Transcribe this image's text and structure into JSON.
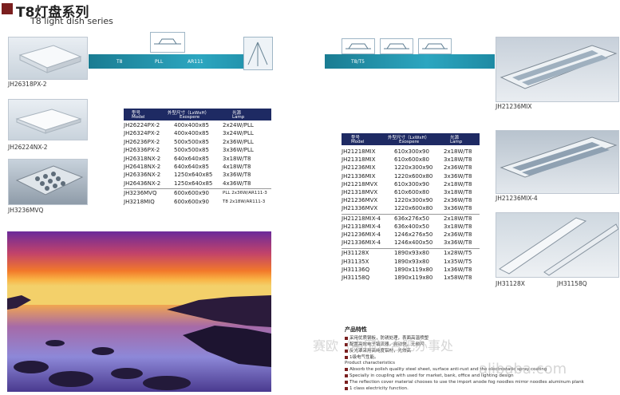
{
  "header": {
    "title_cn": "T8灯盘系列",
    "title_en": "T8 light dish series"
  },
  "left_products": [
    {
      "code": "JH26318PX-2"
    },
    {
      "code": "JH26224NX-2"
    },
    {
      "code": "JH3236MVQ"
    }
  ],
  "left_banner": {
    "labels": [
      "T8",
      "PLL",
      "AR111"
    ]
  },
  "left_table": {
    "headers": [
      {
        "cn": "型号",
        "en": "Model"
      },
      {
        "cn": "外型尺寸（LxWxH）",
        "en": "Exospere"
      },
      {
        "cn": "光源",
        "en": "Lamp"
      }
    ],
    "rows": [
      [
        "JH26224PX-2",
        "400x400x85",
        "2x24W/PLL"
      ],
      [
        "JH26324PX-2",
        "400x400x85",
        "3x24W/PLL"
      ],
      [
        "JH26236PX-2",
        "500x500x85",
        "2x36W/PLL"
      ],
      [
        "JH26336PX-2",
        "500x500x85",
        "3x36W/PLL"
      ],
      [
        "JH26318NX-2",
        "640x640x85",
        "3x18W/T8"
      ],
      [
        "JH26418NX-2",
        "640x640x85",
        "4x18W/T8"
      ],
      [
        "JH26336NX-2",
        "1250x640x85",
        "3x36W/T8"
      ],
      [
        "JH26436NX-2",
        "1250x640x85",
        "4x36W/T8"
      ],
      [
        "JH3236MVQ",
        "600x600x90",
        "PLL 2x36W/AR111-3"
      ],
      [
        "JH3218MIQ",
        "600x600x90",
        "T8 2x18W/AR111-3"
      ]
    ]
  },
  "right_banner": {
    "labels": [
      "T8/T5"
    ]
  },
  "right_table": {
    "headers": [
      {
        "cn": "型号",
        "en": "Model"
      },
      {
        "cn": "外型尺寸（LxWxH）",
        "en": "Exospere"
      },
      {
        "cn": "光源",
        "en": "Lamp"
      }
    ],
    "group1": [
      [
        "JH21218MIX",
        "610x300x90",
        "2x18W/T8"
      ],
      [
        "JH21318MIX",
        "610x600x80",
        "3x18W/T8"
      ],
      [
        "JH21236MIX",
        "1220x300x90",
        "2x36W/T8"
      ],
      [
        "JH21336MIX",
        "1220x600x80",
        "3x36W/T8"
      ],
      [
        "JH21218MVX",
        "610x300x90",
        "2x18W/T8"
      ],
      [
        "JH21318MVX",
        "610x600x80",
        "3x18W/T8"
      ],
      [
        "JH21236MVX",
        "1220x300x90",
        "2x36W/T8"
      ],
      [
        "JH21336MVX",
        "1220x600x80",
        "3x36W/T8"
      ]
    ],
    "group2": [
      [
        "JH21218MIX-4",
        "636x276x50",
        "2x18W/T8"
      ],
      [
        "JH21318MIX-4",
        "636x400x50",
        "3x18W/T8"
      ],
      [
        "JH21236MIX-4",
        "1246x276x50",
        "2x36W/T8"
      ],
      [
        "JH21336MIX-4",
        "1246x400x50",
        "3x36W/T8"
      ]
    ],
    "group3": [
      [
        "JH31128X",
        "1890x93x80",
        "1x28W/T5"
      ],
      [
        "JH31135X",
        "1890x93x80",
        "1x35W/T5"
      ],
      [
        "JH31136Q",
        "1890x119x80",
        "1x36W/T8"
      ],
      [
        "JH31158Q",
        "1890x119x80",
        "1x58W/T8"
      ]
    ]
  },
  "right_products": [
    {
      "code": "JH21236MIX"
    },
    {
      "code": "JH21236MIX-4"
    },
    {
      "code": "JH31128X"
    },
    {
      "code": "JH31158Q"
    }
  ],
  "features": {
    "title": "产品特性",
    "cn_lines": [
      "采用优质钢板，防锈处理，表面高温喷塑",
      "配置高效电子镇流器，启动快，无频闪",
      "反光罩采用高纯度铝材，光效高",
      "1级电气性能。"
    ],
    "en_title": "Product characteristics",
    "en_lines": [
      "Absorb the polish quality steel sheet, surface anti-rust and the electrostatic spray coating",
      "Specially in coupling with used for market, bank, office and lighting design",
      "The reflection cover material chooses to use the import anode fog noodles mirror noodles aluminum plank",
      "1 class electricity function."
    ]
  },
  "watermark": {
    "cn": "赛欧（中国）合肥办事处",
    "en": "alibaba.com"
  }
}
